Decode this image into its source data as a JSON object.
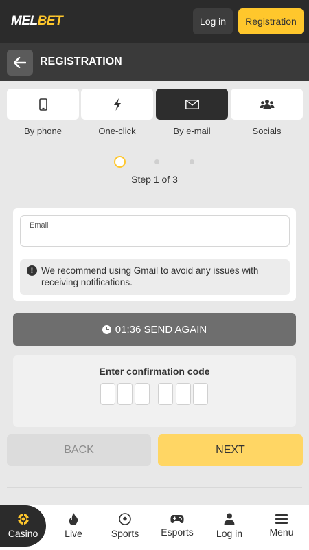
{
  "header": {
    "logo_part1": "MEL",
    "logo_part2": "BET",
    "login_label": "Log in",
    "registration_label": "Registration"
  },
  "subheader": {
    "title": "REGISTRATION",
    "back_icon": "arrow-left-icon"
  },
  "tabs": [
    {
      "label": "By phone",
      "icon": "phone-icon",
      "active": false
    },
    {
      "label": "One-click",
      "icon": "lightning-icon",
      "active": false
    },
    {
      "label": "By e-mail",
      "icon": "envelope-icon",
      "active": true
    },
    {
      "label": "Socials",
      "icon": "users-icon",
      "active": false
    }
  ],
  "stepper": {
    "current_step": 1,
    "total_steps": 3,
    "text": "Step 1 of 3"
  },
  "form": {
    "email_label": "Email",
    "email_value": "",
    "notice": "We recommend using Gmail to avoid any issues with receiving notifications."
  },
  "resend": {
    "timer": "01:36",
    "label": "SEND AGAIN"
  },
  "confirmation": {
    "title": "Enter confirmation code",
    "digits": [
      "",
      "",
      "",
      "",
      "",
      ""
    ]
  },
  "actions": {
    "back_label": "BACK",
    "next_label": "NEXT"
  },
  "bottom_nav": [
    {
      "label": "Casino",
      "icon": "casino-chip-icon",
      "active": true
    },
    {
      "label": "Live",
      "icon": "flame-icon",
      "active": false
    },
    {
      "label": "Sports",
      "icon": "soccer-ball-icon",
      "active": false
    },
    {
      "label": "Esports",
      "icon": "gamepad-icon",
      "active": false
    },
    {
      "label": "Log in",
      "icon": "user-icon",
      "active": false
    },
    {
      "label": "Menu",
      "icon": "menu-icon",
      "active": false
    }
  ],
  "colors": {
    "accent": "#ffc72c",
    "header_bg": "#2b2b2b",
    "subheader_bg": "#3a3a3a",
    "page_bg": "#e8e8e8"
  }
}
